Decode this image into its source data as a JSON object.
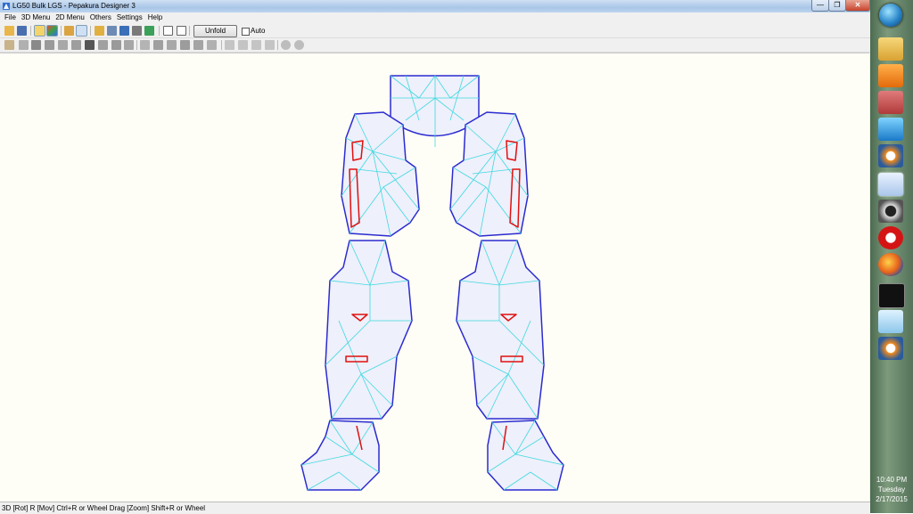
{
  "window": {
    "title": "LG50 Bulk LGS - Pepakura Designer 3",
    "min_glyph": "—",
    "max_glyph": "❐",
    "close_glyph": "✕"
  },
  "menu": [
    "File",
    "3D Menu",
    "2D Menu",
    "Others",
    "Settings",
    "Help"
  ],
  "toolbar": {
    "unfold_label": "Unfold",
    "auto_label": "Auto",
    "auto_checked": false,
    "row1_icons": [
      "open-icon",
      "save-icon",
      "light-icon",
      "texture-icon",
      "flap-icon",
      "edit-icon",
      "select-icon",
      "add-icon",
      "anchor-icon",
      "print-icon",
      "rotate-view-icon",
      "view-2d-icon",
      "view-3d-icon"
    ],
    "row2_icons": [
      "pick-face-icon",
      "join-icon",
      "cut-icon",
      "arrange-icon",
      "edge-icon",
      "mirror-icon",
      "spin-icon",
      "stretch-icon",
      "undo-icon",
      "fit-icon",
      "zoom-icon",
      "move-icon",
      "scale-icon",
      "grid-icon",
      "align-icon",
      "align-left-icon",
      "align-center-icon",
      "align-right-icon",
      "distribute-icon",
      "redo-icon",
      "refresh-icon"
    ]
  },
  "status_text": "3D [Rot] R [Mov] Ctrl+R or Wheel Drag [Zoom] Shift+R or Wheel",
  "taskbar": {
    "pinned_icons": [
      "start-orb",
      "explorer-icon",
      "media-player-icon",
      "paint-tool-icon",
      "3d-box-icon",
      "blender-icon",
      "pepakura-icon",
      "pc-tool-icon",
      "opera-icon",
      "firefox-icon",
      "cmd-icon",
      "notes-icon",
      "blender-icon-2"
    ],
    "clock_time": "10:40 PM",
    "clock_day": "Tuesday",
    "clock_date": "2/17/2015"
  },
  "colors": {
    "titlebar": "#a9c6e8",
    "viewport_bg": "#fffef6",
    "mesh_edge": "#2b2bd0",
    "mesh_fold": "#3fd9e0",
    "mesh_fill": "#eef0fb",
    "mesh_cut": "#e01010"
  }
}
